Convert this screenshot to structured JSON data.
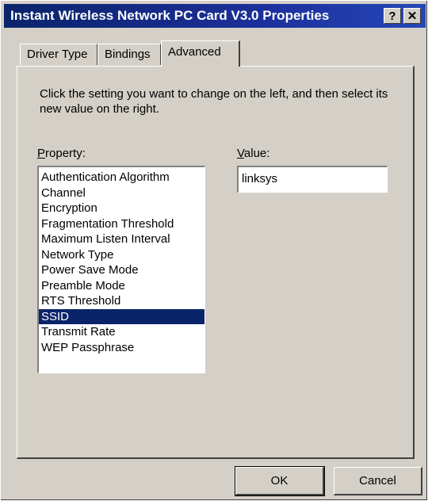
{
  "window": {
    "title": "Instant Wireless Network PC Card V3.0 Properties",
    "help_glyph": "?",
    "close_glyph": "✕"
  },
  "tabs": [
    {
      "label": "Driver Type",
      "active": false
    },
    {
      "label": "Bindings",
      "active": false
    },
    {
      "label": "Advanced",
      "active": true
    }
  ],
  "advanced": {
    "instructions": "Click the setting you want to change on the left, and then select its new value on the right.",
    "property_label": "Property:",
    "property_label_mnemonic": "P",
    "property_label_rest": "roperty:",
    "value_label": "Value:",
    "value_label_mnemonic": "V",
    "value_label_rest": "alue:",
    "properties": [
      "Authentication Algorithm",
      "Channel",
      "Encryption",
      "Fragmentation Threshold",
      "Maximum Listen Interval",
      "Network Type",
      "Power Save Mode",
      "Preamble Mode",
      "RTS Threshold",
      "SSID",
      "Transmit Rate",
      "WEP Passphrase"
    ],
    "selected_property": "SSID",
    "value": "linksys"
  },
  "buttons": {
    "ok_label": "OK",
    "cancel_label": "Cancel"
  },
  "colors": {
    "title_bar": "#0a246a",
    "selection": "#0a246a",
    "face": "#d4d0c8"
  }
}
